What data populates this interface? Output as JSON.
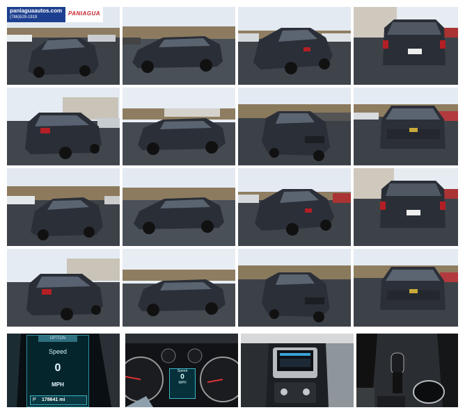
{
  "dealer": {
    "domain": "paniaguaautos.com",
    "phone": "(786)529-1919",
    "brand": "PANIAGUA"
  },
  "cluster": {
    "option_label": "OPTION",
    "speed_label": "Speed",
    "speed_value": "0",
    "speed_unit": "MPH",
    "gear": "P",
    "odometer": "178641 mi"
  },
  "small_cluster": {
    "speed_label": "Speed",
    "speed_value": "0",
    "speed_unit": "MPH"
  },
  "colors": {
    "vehicle": "#2c3038",
    "sky": "#dfe7f0",
    "asphalt": "#3b4047",
    "dealer_blue": "#1c3f8f",
    "dealer_red": "#c8202a"
  }
}
